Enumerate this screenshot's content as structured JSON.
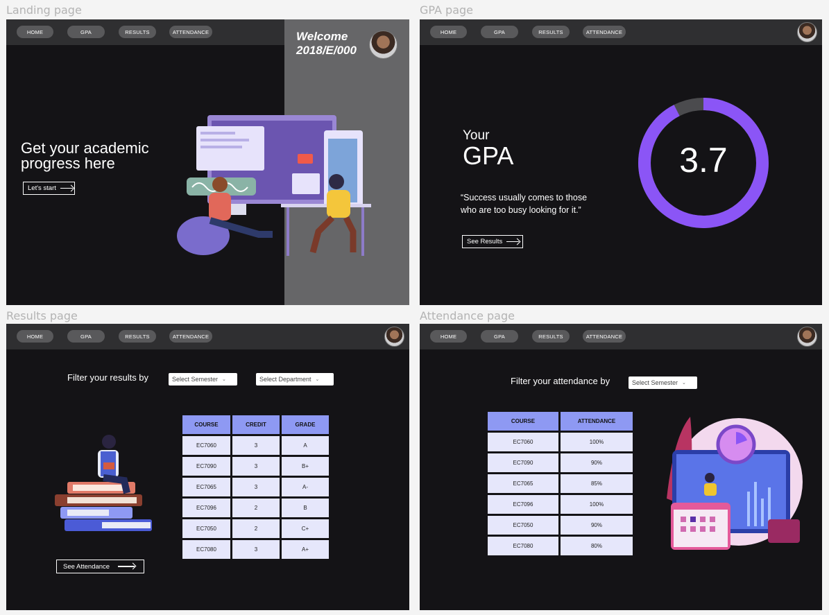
{
  "frames": {
    "landing": {
      "label": "Landing page"
    },
    "gpa": {
      "label": "GPA page"
    },
    "results": {
      "label": "Results page"
    },
    "attendance": {
      "label": "Attendance page"
    }
  },
  "nav": {
    "home": "HOME",
    "gpa": "GPA",
    "results": "RESULTS",
    "attendance": "ATTENDANCE"
  },
  "landing": {
    "welcome": "Welcome",
    "user_id": "2018/E/000",
    "headline_line1": "Get your academic",
    "headline_line2": "progress here",
    "cta": "Let's start"
  },
  "gpa_page": {
    "your": "Your",
    "gpa": "GPA",
    "value": "3.7",
    "gpa_fraction": 0.925,
    "quote_line1": "“Success usually comes to those",
    "quote_line2": "who are too busy looking for it.”",
    "cta": "See Results"
  },
  "results_page": {
    "filter_label": "Filter your results by",
    "semester_placeholder": "Select Semester",
    "department_placeholder": "Select Department",
    "headers": [
      "COURSE",
      "CREDIT",
      "GRADE"
    ],
    "rows": [
      [
        "EC7060",
        "3",
        "A"
      ],
      [
        "EC7090",
        "3",
        "B+"
      ],
      [
        "EC7065",
        "3",
        "A-"
      ],
      [
        "EC7096",
        "2",
        "B"
      ],
      [
        "EC7050",
        "2",
        "C+"
      ],
      [
        "EC7080",
        "3",
        "A+"
      ]
    ],
    "cta": "See Attendance"
  },
  "attendance_page": {
    "filter_label": "Filter your attendance by",
    "semester_placeholder": "Select Semester",
    "headers": [
      "COURSE",
      "ATTENDANCE"
    ],
    "rows": [
      [
        "EC7060",
        "100%"
      ],
      [
        "EC7090",
        "90%"
      ],
      [
        "EC7065",
        "85%"
      ],
      [
        "EC7096",
        "100%"
      ],
      [
        "EC7050",
        "90%"
      ],
      [
        "EC7080",
        "80%"
      ]
    ]
  },
  "colors": {
    "accent": "#8b55f6",
    "ring_track": "#4b4b4e",
    "table_header": "#8e99f3",
    "table_cell": "#e6e7fb",
    "frame_bg": "#141316"
  }
}
